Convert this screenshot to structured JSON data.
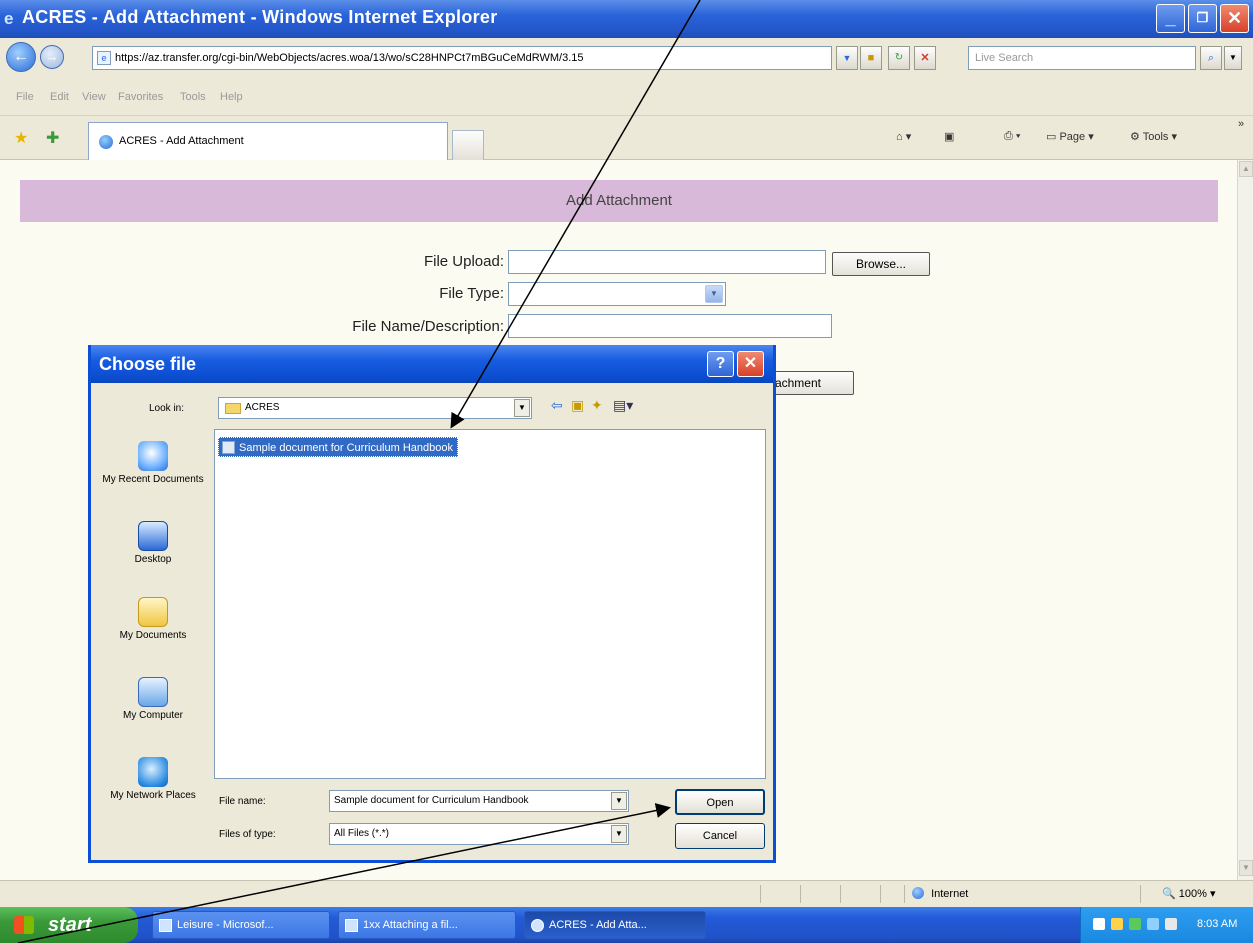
{
  "window": {
    "title": "ACRES - Add Attachment - Windows Internet Explorer",
    "minimize": "_",
    "maximize": "❐",
    "close": "✕"
  },
  "address_bar": {
    "url": "https://az.transfer.org/cgi-bin/WebObjects/acres.woa/13/wo/sC28HNPCt7mBGuCeMdRWM/3.15",
    "search_placeholder": "Live Search"
  },
  "menu": [
    "File",
    "Edit",
    "View",
    "Favorites",
    "Tools",
    "Help"
  ],
  "tab": {
    "label": "ACRES - Add Attachment"
  },
  "commands": {
    "page": "Page",
    "tools": "Tools"
  },
  "page": {
    "header": "Add Attachment",
    "file_upload_label": "File Upload:",
    "browse_button": "Browse...",
    "file_type_label": "File Type:",
    "file_name_label": "File Name/Description:",
    "add_attachment_button": "Add Attachment"
  },
  "dialog": {
    "title": "Choose file",
    "help": "?",
    "close": "✕",
    "look_in_label": "Look in:",
    "look_in_value": "ACRES",
    "places": [
      {
        "label": "My Recent Documents",
        "icon": "recent-documents-icon"
      },
      {
        "label": "Desktop",
        "icon": "desktop-icon"
      },
      {
        "label": "My Documents",
        "icon": "my-documents-icon"
      },
      {
        "label": "My Computer",
        "icon": "my-computer-icon"
      },
      {
        "label": "My Network Places",
        "icon": "network-places-icon"
      }
    ],
    "files": [
      "Sample document for Curriculum Handbook"
    ],
    "file_name_label": "File name:",
    "file_name_value": "Sample document for Curriculum Handbook",
    "files_of_type_label": "Files of type:",
    "files_of_type_value": "All Files (*.*)",
    "open_button": "Open",
    "cancel_button": "Cancel"
  },
  "status_bar": {
    "zone": "Internet",
    "zoom": "100%"
  },
  "taskbar": {
    "start": "start",
    "buttons": [
      "Leisure - Microsof...",
      "1xx Attaching a fil...",
      "ACRES - Add Atta..."
    ],
    "clock": "8:03 AM"
  },
  "colors": {
    "header_band": "#d8b9d9",
    "page_background": "#fbfbf2",
    "xp_blue": "#0b4fd6",
    "selection": "#316ac5"
  }
}
